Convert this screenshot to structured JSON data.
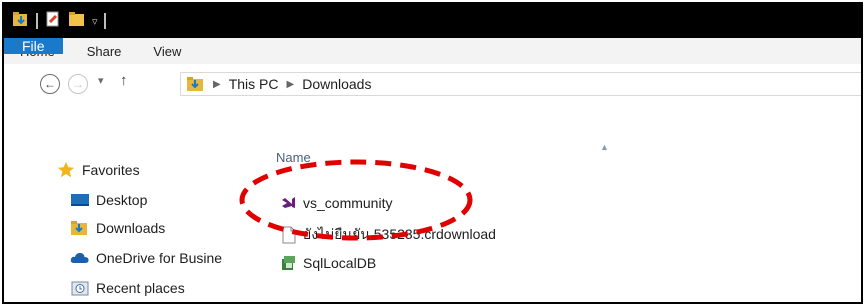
{
  "ribbon": {
    "tabs": [
      {
        "label": "File"
      },
      {
        "label": "Home"
      },
      {
        "label": "Share"
      },
      {
        "label": "View"
      }
    ]
  },
  "address": {
    "crumbs": [
      "This PC",
      "Downloads"
    ]
  },
  "nav_pane": {
    "items": [
      {
        "label": "Favorites",
        "icon": "star-icon"
      },
      {
        "label": "Desktop",
        "icon": "desktop-icon"
      },
      {
        "label": "Downloads",
        "icon": "downloads-folder-icon"
      },
      {
        "label": "OneDrive for Busine",
        "icon": "onedrive-icon"
      },
      {
        "label": "Recent places",
        "icon": "recent-places-icon"
      }
    ]
  },
  "file_list": {
    "column_header": "Name",
    "items": [
      {
        "name": "vs_community",
        "icon": "visual-studio-icon"
      },
      {
        "name": "ยังไม่ยืนยัน 535235.crdownload",
        "icon": "generic-file-icon"
      },
      {
        "name": "SqlLocalDB",
        "icon": "installer-package-icon"
      }
    ]
  },
  "colors": {
    "file_tab": "#1979ca",
    "annotation": "#e00000",
    "visual_studio": "#68217a"
  }
}
